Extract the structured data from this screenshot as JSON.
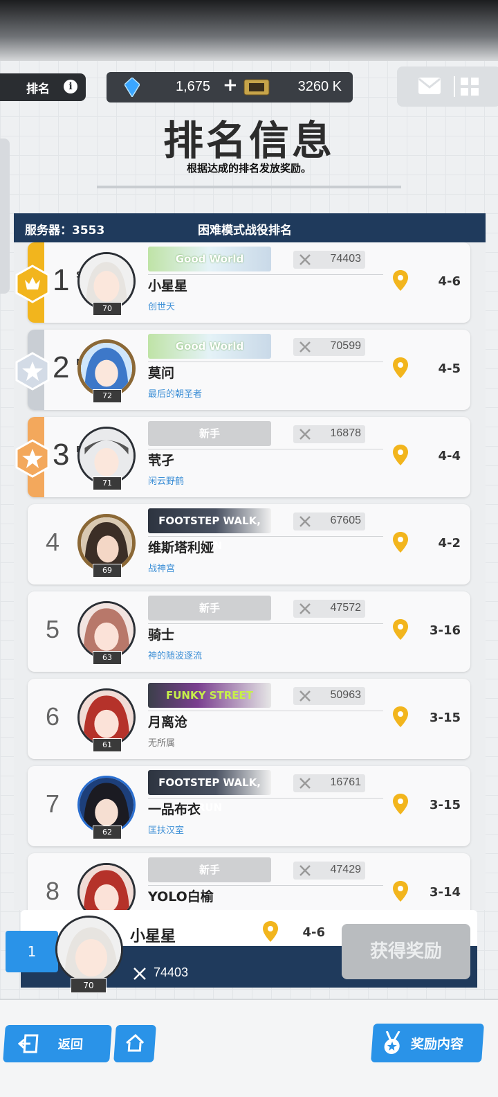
{
  "top": {
    "ranking_tab": "排名",
    "gems": "1,675",
    "gold": "3260 K"
  },
  "header": {
    "title": "排名信息",
    "subtitle": "根据达成的排名发放奖励。"
  },
  "panel": {
    "server": "服务器：3553",
    "title": "困难模式战役排名"
  },
  "rows": [
    {
      "rank": "1",
      "suffix": "ST",
      "level": "70",
      "banner": "Good World",
      "score": "74403",
      "name": "小星星",
      "guild": "创世天",
      "stage": "4-6"
    },
    {
      "rank": "2",
      "suffix": "ND",
      "level": "72",
      "banner": "Good World",
      "score": "70599",
      "name": "莫问",
      "guild": "最后的朝圣者",
      "stage": "4-5"
    },
    {
      "rank": "3",
      "suffix": "RD",
      "level": "71",
      "banner": "新手",
      "score": "16878",
      "name": "茕孑",
      "guild": "闲云野鹤",
      "stage": "4-4"
    },
    {
      "rank": "4",
      "level": "69",
      "banner": "FOOTSTEP WALK, RUN",
      "score": "67605",
      "name": "维斯塔利娅",
      "guild": "战神宫",
      "stage": "4-2"
    },
    {
      "rank": "5",
      "level": "63",
      "banner": "新手",
      "score": "47572",
      "name": "骑士",
      "guild": "神的随波逐流",
      "stage": "3-16"
    },
    {
      "rank": "6",
      "level": "61",
      "banner": "FUNKY STREET",
      "score": "50963",
      "name": "月离沧",
      "guild": "无所属",
      "stage": "3-15"
    },
    {
      "rank": "7",
      "level": "62",
      "banner": "FOOTSTEP WALK, RUN",
      "score": "16761",
      "name": "一品布衣",
      "guild": "匡扶汉室",
      "stage": "3-15"
    },
    {
      "rank": "8",
      "level": "",
      "banner": "新手",
      "score": "47429",
      "name": "YOLO白榆",
      "guild": "",
      "stage": "3-14"
    }
  ],
  "me": {
    "rank": "1",
    "name": "小星星",
    "stage": "4-6",
    "score": "74403",
    "level": "70",
    "claim_label": "获得奖励"
  },
  "footer": {
    "back_label": "返回",
    "reward_label": "奖励内容"
  },
  "colors": {
    "gold": "#f2b51d",
    "silver": "#c9ced4",
    "bronze": "#f3a85c",
    "navy": "#1f3a5c",
    "accent": "#2a93e8"
  }
}
